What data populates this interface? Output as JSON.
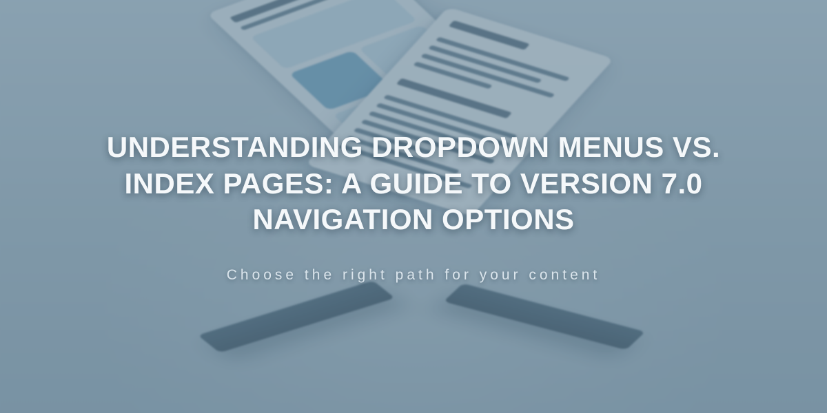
{
  "hero": {
    "title": "UNDERSTANDING DROPDOWN MENUS VS. INDEX PAGES: A GUIDE TO VERSION 7.0 NAVIGATION OPTIONS",
    "subtitle": "Choose the right path for your content"
  }
}
